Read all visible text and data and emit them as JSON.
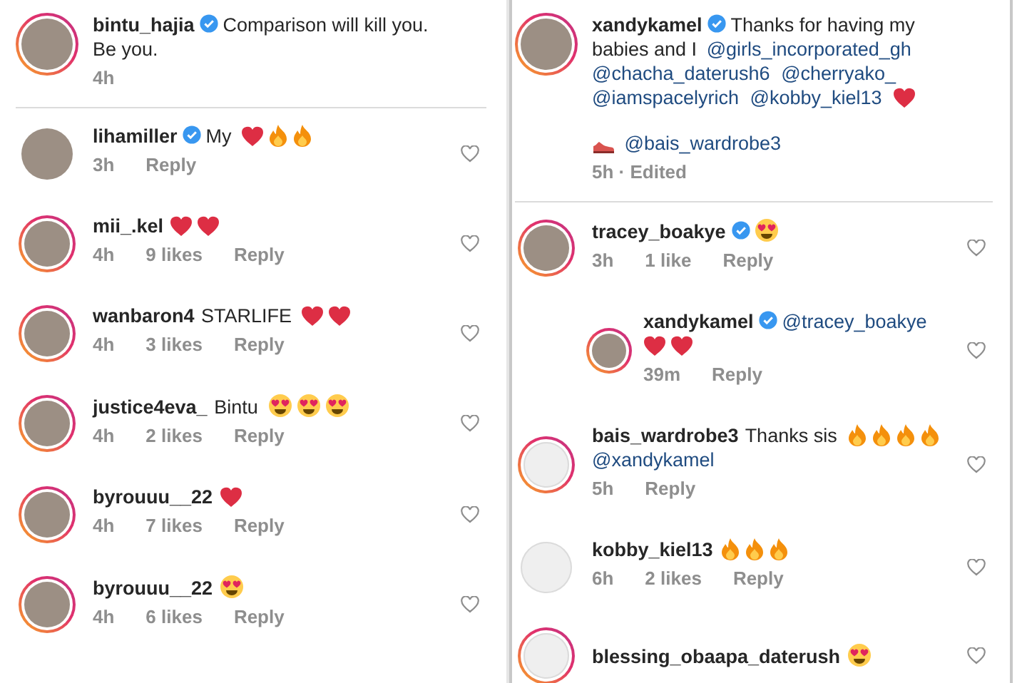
{
  "panels": [
    {
      "caption": {
        "avatar": {
          "photo": true,
          "story_ring": true
        },
        "username": "bintu_hajia",
        "verified": true,
        "paragraphs": [
          [
            {
              "kind": "text",
              "text": "Comparison will kill you. Be you."
            }
          ]
        ],
        "meta": "4h"
      },
      "comments": [
        {
          "avatar": {
            "photo": true,
            "story_ring": false
          },
          "username": "lihamiller",
          "verified": true,
          "parts": [
            {
              "kind": "text",
              "text": "My"
            },
            {
              "kind": "heart"
            },
            {
              "kind": "fire"
            },
            {
              "kind": "fire"
            }
          ],
          "time": "3h",
          "reply": "Reply"
        },
        {
          "avatar": {
            "photo": true,
            "story_ring": true
          },
          "username": "mii_.kel",
          "verified": false,
          "parts": [
            {
              "kind": "heart"
            },
            {
              "kind": "heart"
            }
          ],
          "time": "4h",
          "likes": "9 likes",
          "reply": "Reply"
        },
        {
          "avatar": {
            "photo": true,
            "story_ring": true
          },
          "username": "wanbaron4",
          "verified": false,
          "parts": [
            {
              "kind": "text",
              "text": "STARLIFE"
            },
            {
              "kind": "heart"
            },
            {
              "kind": "heart"
            }
          ],
          "time": "4h",
          "likes": "3 likes",
          "reply": "Reply"
        },
        {
          "avatar": {
            "photo": true,
            "story_ring": true
          },
          "username": "justice4eva_",
          "verified": false,
          "parts": [
            {
              "kind": "text",
              "text": "Bintu"
            },
            {
              "kind": "heart_eyes"
            },
            {
              "kind": "heart_eyes"
            },
            {
              "kind": "heart_eyes"
            }
          ],
          "time": "4h",
          "likes": "2 likes",
          "reply": "Reply"
        },
        {
          "avatar": {
            "photo": true,
            "story_ring": true
          },
          "username": "byrouuu__22",
          "verified": false,
          "parts": [
            {
              "kind": "heart"
            }
          ],
          "time": "4h",
          "likes": "7 likes",
          "reply": "Reply"
        },
        {
          "avatar": {
            "photo": true,
            "story_ring": true
          },
          "username": "byrouuu__22",
          "verified": false,
          "parts": [
            {
              "kind": "heart_eyes"
            }
          ],
          "time": "4h",
          "likes": "6 likes",
          "reply": "Reply"
        }
      ]
    },
    {
      "caption": {
        "avatar": {
          "photo": true,
          "story_ring": true
        },
        "username": "xandykamel",
        "verified": true,
        "paragraphs": [
          [
            {
              "kind": "text",
              "text": "Thanks for having my babies and I"
            },
            {
              "kind": "mention",
              "text": "@girls_incorporated_gh"
            },
            {
              "kind": "mention",
              "text": "@chacha_daterush6"
            },
            {
              "kind": "mention",
              "text": "@cherryako_"
            },
            {
              "kind": "mention",
              "text": "@iamspacelyrich"
            },
            {
              "kind": "mention",
              "text": "@kobby_kiel13"
            },
            {
              "kind": "heart"
            }
          ],
          [
            {
              "kind": "shoe"
            },
            {
              "kind": "mention",
              "text": "@bais_wardrobe3"
            }
          ]
        ],
        "meta": "5h · Edited"
      },
      "comments": [
        {
          "avatar": {
            "photo": true,
            "story_ring": true
          },
          "username": "tracey_boakye",
          "verified": true,
          "parts": [
            {
              "kind": "heart_eyes"
            }
          ],
          "time": "3h",
          "likes": "1 like",
          "reply": "Reply",
          "children": [
            {
              "avatar": {
                "photo": true,
                "story_ring": true
              },
              "username": "xandykamel",
              "verified": true,
              "parts": [
                {
                  "kind": "mention",
                  "text": "@tracey_boakye"
                },
                {
                  "kind": "heart"
                },
                {
                  "kind": "heart"
                }
              ],
              "time": "39m",
              "reply": "Reply"
            }
          ]
        },
        {
          "avatar": {
            "photo": false,
            "story_ring": true
          },
          "username": "bais_wardrobe3",
          "verified": false,
          "parts": [
            {
              "kind": "text",
              "text": "Thanks sis"
            },
            {
              "kind": "fire"
            },
            {
              "kind": "fire"
            },
            {
              "kind": "fire"
            },
            {
              "kind": "fire"
            },
            {
              "kind": "mention",
              "text": "@xandykamel"
            }
          ],
          "time": "5h",
          "reply": "Reply"
        },
        {
          "avatar": {
            "photo": false,
            "story_ring": false
          },
          "username": "kobby_kiel13",
          "verified": false,
          "parts": [
            {
              "kind": "fire"
            },
            {
              "kind": "fire"
            },
            {
              "kind": "fire"
            }
          ],
          "time": "6h",
          "likes": "2 likes",
          "reply": "Reply"
        },
        {
          "avatar": {
            "photo": false,
            "story_ring": true
          },
          "username": "blessing_obaapa_daterush",
          "verified": false,
          "parts": [
            {
              "kind": "heart_eyes"
            }
          ]
        }
      ]
    }
  ]
}
